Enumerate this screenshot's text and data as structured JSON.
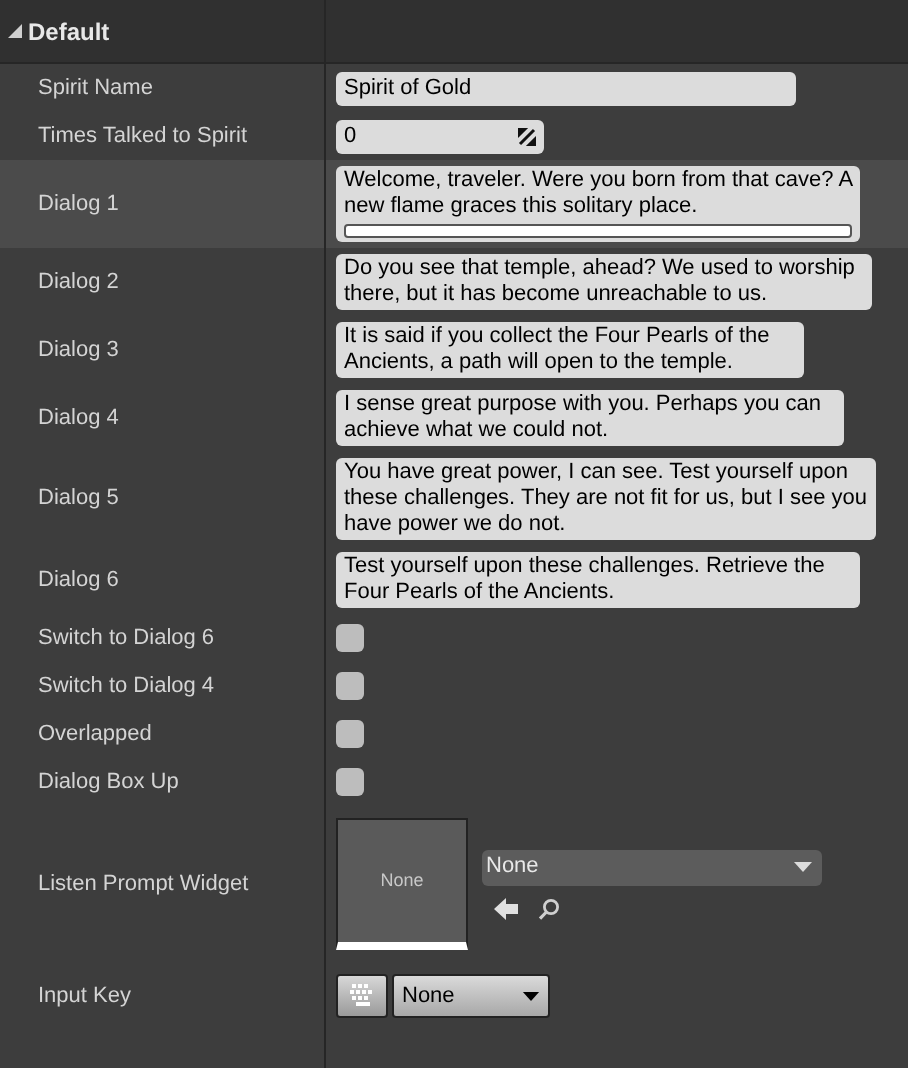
{
  "section": {
    "title": "Default",
    "expanded": true
  },
  "properties": [
    {
      "kind": "text",
      "label": "Spirit Name",
      "value": "Spirit of Gold"
    },
    {
      "kind": "number",
      "label": "Times Talked to Spirit",
      "value": "0"
    },
    {
      "kind": "dialog",
      "label": "Dialog 1",
      "value": "Welcome, traveler. Were you born from that cave? A new flame graces this solitary place.",
      "selected": true,
      "editing": true
    },
    {
      "kind": "dialog",
      "label": "Dialog 2",
      "value": "Do you see that temple, ahead? We used to worship there, but it has become unreachable to us.",
      "selected": false
    },
    {
      "kind": "dialog",
      "label": "Dialog 3",
      "value": "It is said if you collect the Four Pearls of the Ancients, a path will open to the temple.",
      "selected": false
    },
    {
      "kind": "dialog",
      "label": "Dialog 4",
      "value": "I sense great purpose with you. Perhaps you can achieve what we could not.",
      "selected": false
    },
    {
      "kind": "dialog",
      "label": "Dialog 5",
      "value": "You have great power, I can see. Test yourself upon these challenges. They are not fit for us, but I see you have power we do not.",
      "selected": false
    },
    {
      "kind": "dialog",
      "label": "Dialog 6",
      "value": "Test yourself upon these challenges. Retrieve the Four Pearls of the Ancients.",
      "selected": false
    },
    {
      "kind": "checkbox",
      "label": "Switch to Dialog 6",
      "checked": false
    },
    {
      "kind": "checkbox",
      "label": "Switch to Dialog 4",
      "checked": false
    },
    {
      "kind": "checkbox",
      "label": "Overlapped",
      "checked": false
    },
    {
      "kind": "checkbox",
      "label": "Dialog Box Up",
      "checked": false
    },
    {
      "kind": "asset",
      "label": "Listen Prompt Widget",
      "thumbnail": "None",
      "value": "None"
    },
    {
      "kind": "key",
      "label": "Input Key",
      "value": "None"
    }
  ]
}
